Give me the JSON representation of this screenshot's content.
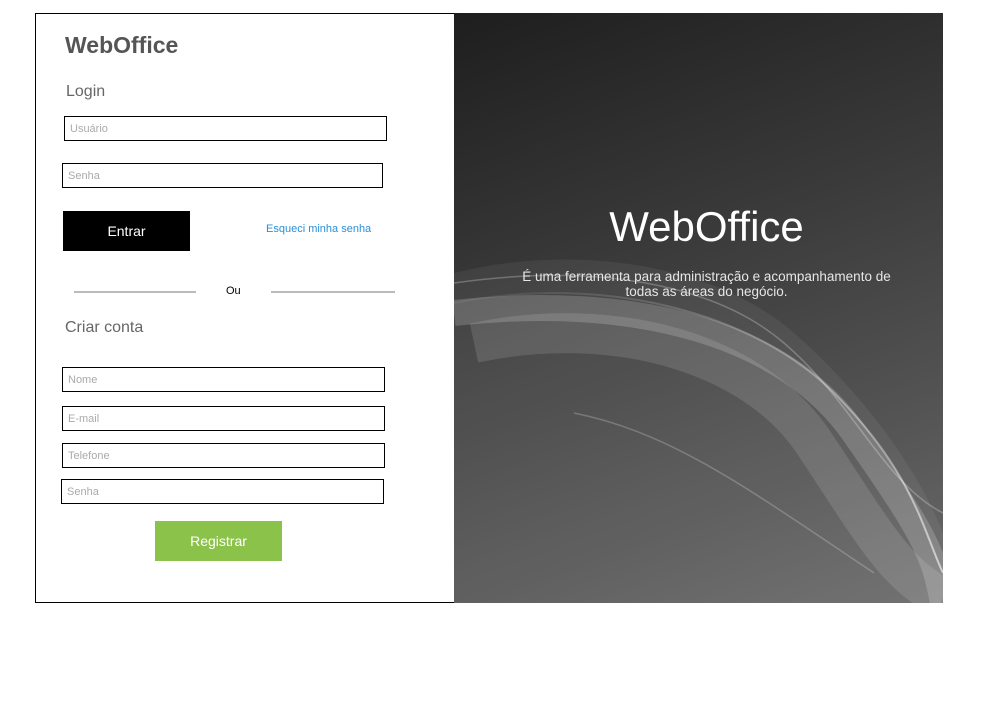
{
  "brand": "WebOffice",
  "login": {
    "title": "Login",
    "username_placeholder": "Usuário",
    "password_placeholder": "Senha",
    "submit_label": "Entrar",
    "forgot_label": "Esqueci minha senha"
  },
  "divider": "Ou",
  "register": {
    "title": "Criar conta",
    "name_placeholder": "Nome",
    "email_placeholder": "E-mail",
    "phone_placeholder": "Telefone",
    "password_placeholder": "Senha",
    "submit_label": "Registrar"
  },
  "hero": {
    "title": "WebOffice",
    "subtitle": "É uma ferramenta para administração e acompanhamento de todas as áreas do negócio."
  },
  "colors": {
    "register_button": "#8bc34a",
    "login_button": "#000000",
    "link": "#2a8fd8"
  }
}
